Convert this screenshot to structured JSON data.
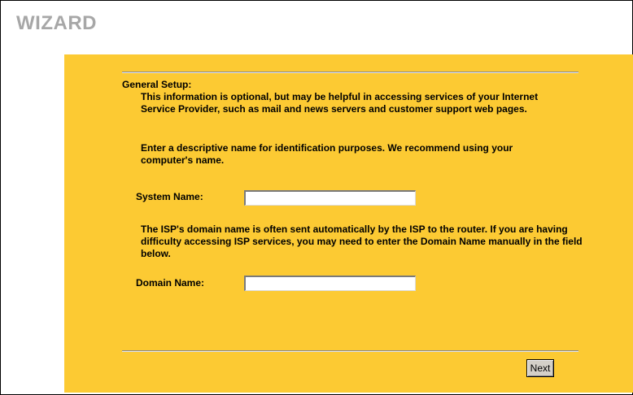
{
  "wizard": {
    "title": "WIZARD"
  },
  "general_setup": {
    "heading": "General Setup:",
    "intro": "This information is optional, but may be helpful in accessing services of your Internet Service Provider, such as mail and news servers and customer support web pages.",
    "name_hint": "Enter a descriptive name for identification purposes. We recommend using your computer's name.",
    "system_name_label": "System Name:",
    "system_name_value": "",
    "domain_hint": "The ISP's domain name is often sent automatically by the ISP to the router. If you are having difficulty accessing ISP services, you may need to enter the Domain Name manually in the field below.",
    "domain_name_label": "Domain Name:",
    "domain_name_value": ""
  },
  "buttons": {
    "next": "Next"
  },
  "colors": {
    "panel_background": "#fcca33",
    "title_gray": "#a7a7a7"
  }
}
